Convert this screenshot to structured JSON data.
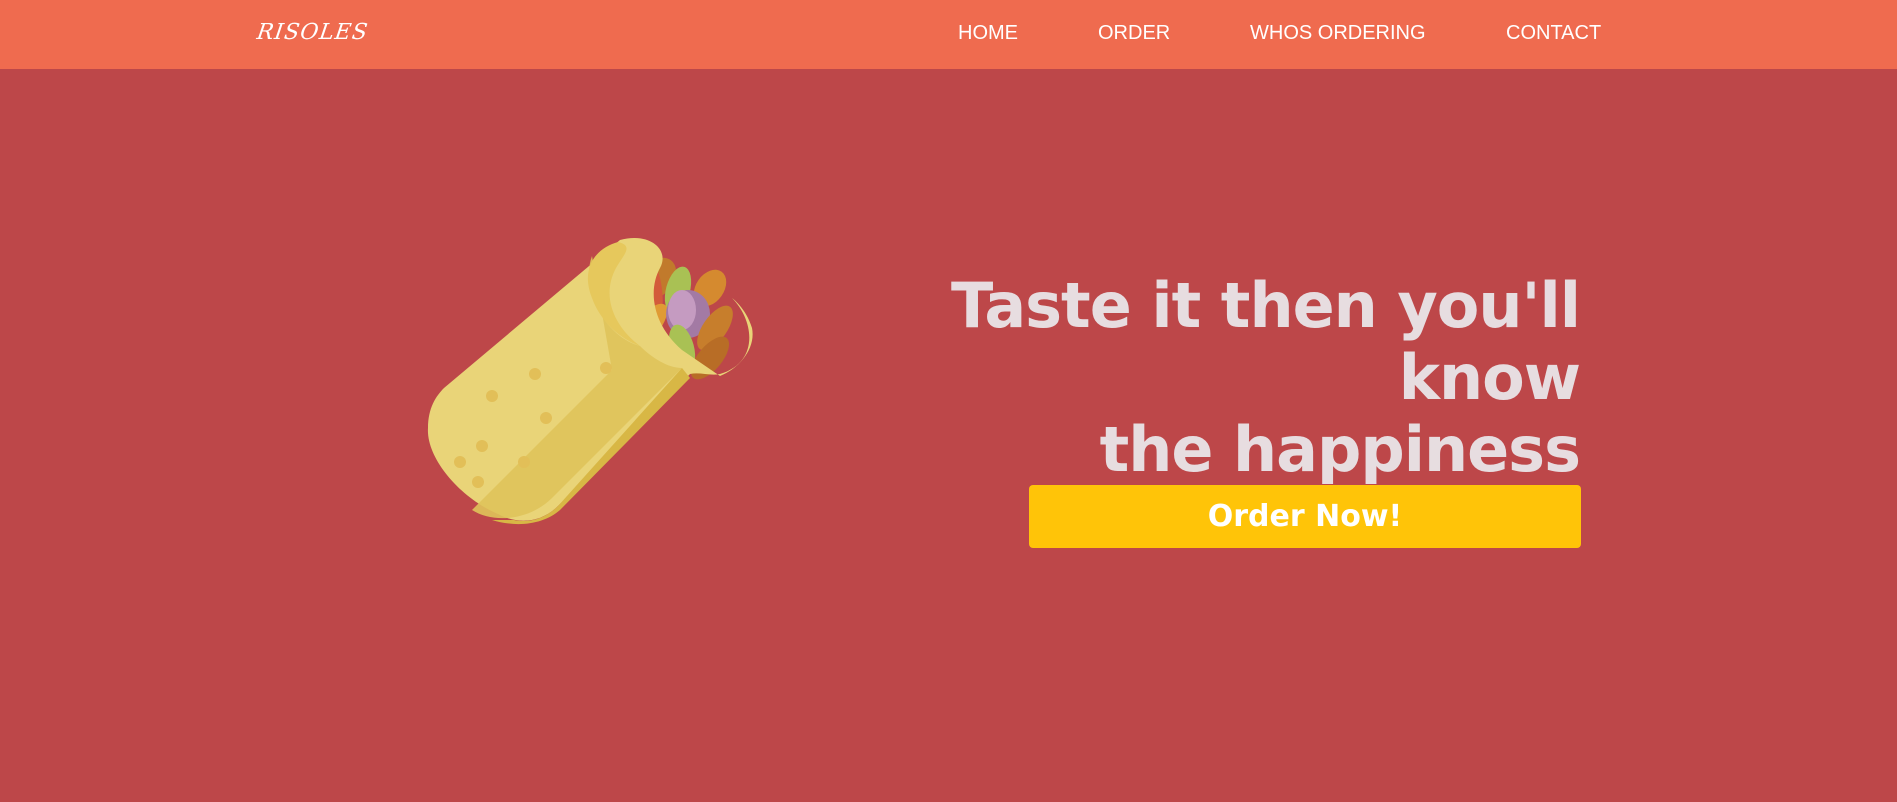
{
  "brand": {
    "logo": "RISOLES"
  },
  "nav": {
    "items": [
      {
        "label": "HOME"
      },
      {
        "label": "ORDER"
      },
      {
        "label": "WHOS ORDERING"
      },
      {
        "label": "CONTACT"
      }
    ]
  },
  "hero": {
    "headline_lines": [
      "Taste it then you'll",
      "know",
      "the happiness"
    ],
    "cta_label": "Order Now!",
    "illustration": "burrito-illustration"
  },
  "colors": {
    "header": "#ef6b4f",
    "background": "#bd4749",
    "cta": "#ffc408",
    "headline": "#e7dde0"
  }
}
